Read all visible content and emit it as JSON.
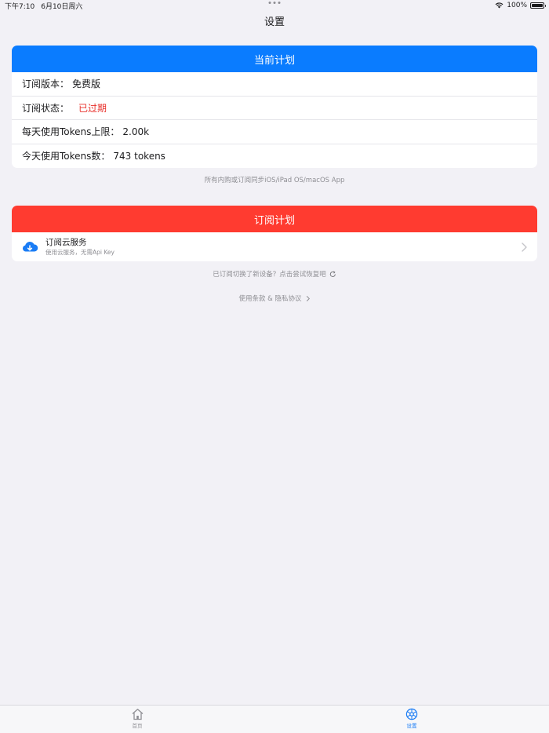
{
  "status_bar": {
    "time": "下午7:10",
    "date": "6月10日周六",
    "battery": "100%",
    "battery_level": 1.0
  },
  "nav": {
    "title": "设置"
  },
  "current_plan": {
    "header": "当前计划",
    "header_color": "#0a7cff",
    "rows": [
      {
        "label": "订阅版本：",
        "value": "免费版"
      },
      {
        "label": "订阅状态：",
        "value": "已过期"
      },
      {
        "label": "每天使用Tokens上限：",
        "value": "2.00k"
      },
      {
        "label": "今天使用Tokens数：",
        "value": "743 tokens"
      }
    ],
    "note": "所有内购或订阅同步iOS/iPad OS/macOS App"
  },
  "subscribe_plan": {
    "header": "订阅计划",
    "header_color": "#ff3b30",
    "service": {
      "icon": "cloud-download-icon",
      "title": "订阅云服务",
      "subtitle": "使用云服务，无需Api Key"
    },
    "restore_text": "已订阅切换了新设备？点击尝试恢复吧",
    "terms_text": "使用条款 & 隐私协议"
  },
  "tabs": [
    {
      "label": "首页",
      "icon": "home-icon",
      "active": false
    },
    {
      "label": "设置",
      "icon": "settings-icon",
      "active": true
    }
  ],
  "colors": {
    "accent": "#1a7cf5",
    "danger": "#e8302b",
    "background": "#f2f1f6"
  }
}
